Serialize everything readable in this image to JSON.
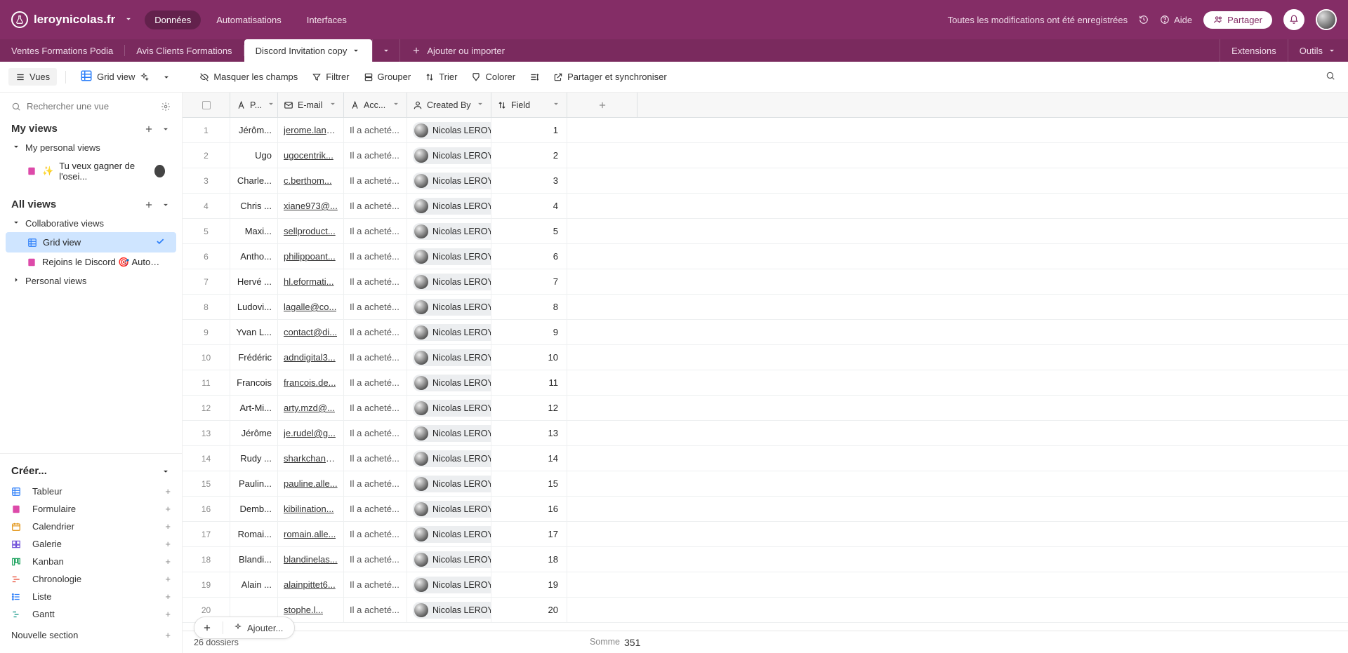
{
  "header": {
    "base_name": "leroynicolas.fr",
    "tabs": {
      "data": "Données",
      "automations": "Automatisations",
      "interfaces": "Interfaces"
    },
    "saved_msg": "Toutes les modifications ont été enregistrées",
    "help": "Aide",
    "share": "Partager"
  },
  "tables": {
    "tabs": [
      "Ventes Formations Podia",
      "Avis Clients Formations",
      "Discord Invitation copy"
    ],
    "active_index": 2,
    "add_import": "Ajouter ou importer",
    "extensions": "Extensions",
    "tools": "Outils"
  },
  "toolbar": {
    "views": "Vues",
    "grid_view": "Grid view",
    "hide_fields": "Masquer les champs",
    "filter": "Filtrer",
    "group": "Grouper",
    "sort": "Trier",
    "color": "Colorer",
    "share_sync": "Partager et synchroniser"
  },
  "sidebar": {
    "search_placeholder": "Rechercher une vue",
    "my_views": "My views",
    "my_personal_views": "My personal views",
    "personal_view_1": "Tu veux gagner de l'osei...",
    "all_views": "All views",
    "collab_views": "Collaborative views",
    "grid_view": "Grid view",
    "discord_view": "Rejoins le Discord 🎯 Automatis...",
    "personal_views": "Personal views",
    "create": "Créer...",
    "tableur": "Tableur",
    "form": "Formulaire",
    "calendar": "Calendrier",
    "gallery": "Galerie",
    "kanban": "Kanban",
    "timeline": "Chronologie",
    "list": "Liste",
    "gantt": "Gantt",
    "new_section": "Nouvelle section"
  },
  "grid": {
    "columns": {
      "p": "P...",
      "email": "E-mail",
      "acc": "Acc...",
      "created_by": "Created By",
      "field": "Field"
    },
    "creator": "Nicolas LEROY",
    "acc_val": "Il a acheté...",
    "rows": [
      {
        "n": 1,
        "p": "Jérôm...",
        "email": "jerome.lanc...",
        "f": 1
      },
      {
        "n": 2,
        "p": "Ugo",
        "email": "ugocentrik...",
        "f": 2
      },
      {
        "n": 3,
        "p": "Charle...",
        "email": "c.berthom...",
        "f": 3
      },
      {
        "n": 4,
        "p": "Chris ...",
        "email": "xiane973@...",
        "f": 4
      },
      {
        "n": 5,
        "p": "Maxi...",
        "email": "sellproduct...",
        "f": 5
      },
      {
        "n": 6,
        "p": "Antho...",
        "email": "philippoant...",
        "f": 6
      },
      {
        "n": 7,
        "p": "Hervé ...",
        "email": "hl.eformati...",
        "f": 7
      },
      {
        "n": 8,
        "p": "Ludovi...",
        "email": "lagalle@co...",
        "f": 8
      },
      {
        "n": 9,
        "p": "Yvan L...",
        "email": "contact@di...",
        "f": 9
      },
      {
        "n": 10,
        "p": "Frédéric",
        "email": "adndigital3...",
        "f": 10
      },
      {
        "n": 11,
        "p": "Francois",
        "email": "francois.de...",
        "f": 11
      },
      {
        "n": 12,
        "p": "Art-Mi...",
        "email": "arty.mzd@...",
        "f": 12
      },
      {
        "n": 13,
        "p": "Jérôme",
        "email": "je.rudel@g...",
        "f": 13
      },
      {
        "n": 14,
        "p": "Rudy ...",
        "email": "sharkchann...",
        "f": 14
      },
      {
        "n": 15,
        "p": "Paulin...",
        "email": "pauline.alle...",
        "f": 15
      },
      {
        "n": 16,
        "p": "Demb...",
        "email": "kibilination...",
        "f": 16
      },
      {
        "n": 17,
        "p": "Romai...",
        "email": "romain.alle...",
        "f": 17
      },
      {
        "n": 18,
        "p": "Blandi...",
        "email": "blandinelas...",
        "f": 18
      },
      {
        "n": 19,
        "p": "Alain ...",
        "email": "alainpittet6...",
        "f": 19
      },
      {
        "n": 20,
        "p": "",
        "email": "stophe.l...",
        "f": 20
      }
    ],
    "record_count": "26 dossiers",
    "sum_label": "Somme",
    "sum_value": "351",
    "add_row": "Ajouter..."
  }
}
